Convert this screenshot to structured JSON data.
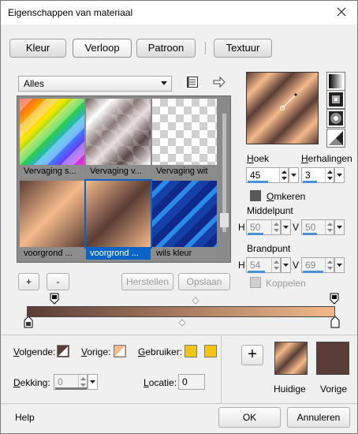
{
  "window": {
    "title": "Eigenschappen van materiaal"
  },
  "tabs": [
    {
      "label": "Kleur",
      "active": false
    },
    {
      "label": "Verloop",
      "active": true
    },
    {
      "label": "Patroon",
      "active": false
    },
    {
      "label": "Textuur",
      "active": false
    }
  ],
  "preset_dropdown": {
    "value": "Alles"
  },
  "swatches": [
    {
      "label": "Vervaging s..."
    },
    {
      "label": "Vervaging v..."
    },
    {
      "label": "Vervaging wit"
    },
    {
      "label": "voorgrond ..."
    },
    {
      "label": "voorgrond ...",
      "selected": true
    },
    {
      "label": "wils kleur"
    }
  ],
  "swatch_buttons": {
    "add": "+",
    "remove": "-",
    "reset": "Herstellen",
    "save": "Opslaan"
  },
  "angle": {
    "label": "Hoek",
    "value": "45"
  },
  "repeats": {
    "label": "Herhalingen",
    "value": "3"
  },
  "invert": {
    "label": "Omkeren"
  },
  "midpoint": {
    "label": "Middelpunt",
    "h_label": "H",
    "h_value": "50",
    "v_label": "V",
    "v_value": "50"
  },
  "focal": {
    "label": "Brandpunt",
    "h_label": "H",
    "h_value": "54",
    "v_label": "V",
    "v_value": "69"
  },
  "link": {
    "label": "Koppelen"
  },
  "bottom": {
    "next_label": "Volgende:",
    "prev_label": "Vorige:",
    "user_label": "Gebruiker:",
    "opacity_label": "Dekking:",
    "opacity_value": "0",
    "location_label": "Locatie:",
    "location_value": "0",
    "add": "+",
    "current_label": "Huidige",
    "previous_label": "Vorige"
  },
  "footer": {
    "help": "Help",
    "ok": "OK",
    "cancel": "Annuleren"
  },
  "colors": {
    "fg_brown": "#5a3d36",
    "bg_peach": "#f4b98a",
    "user_yellow": "#f3c515",
    "selection_blue": "#0a64c8"
  }
}
